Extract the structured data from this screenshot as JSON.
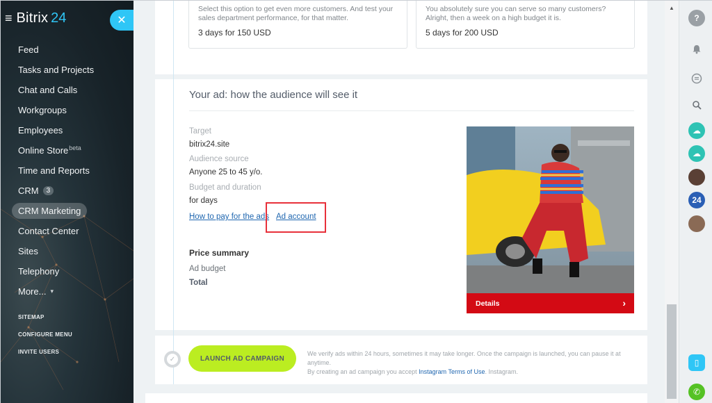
{
  "sidebar": {
    "logo": "Bitrix",
    "logo_num": "24",
    "items": [
      {
        "label": "Feed"
      },
      {
        "label": "Tasks and Projects"
      },
      {
        "label": "Chat and Calls"
      },
      {
        "label": "Workgroups"
      },
      {
        "label": "Employees"
      },
      {
        "label": "Online Store",
        "sup": "beta"
      },
      {
        "label": "Time and Reports"
      },
      {
        "label": "CRM",
        "counter": "3"
      },
      {
        "label": "CRM Marketing"
      },
      {
        "label": "Contact Center"
      },
      {
        "label": "Sites"
      },
      {
        "label": "Telephony"
      },
      {
        "label": "More..."
      }
    ],
    "links": [
      "SITEMAP",
      "CONFIGURE MENU",
      "INVITE USERS"
    ]
  },
  "options": [
    {
      "desc": "Select this option to get even more customers. And test your sales department performance, for that matter.",
      "price": "3 days for 150 USD"
    },
    {
      "desc": "You absolutely sure you can serve so many customers? Alright, then a week on a high budget it is.",
      "price": "5 days for 200 USD"
    }
  ],
  "preview": {
    "title": "Your ad: how the audience will see it",
    "target_label": "Target",
    "target_value": "bitrix24.site",
    "audience_label": "Audience source",
    "audience_value": "Anyone 25 to 45 y/o.",
    "budget_label": "Budget and duration",
    "budget_value": "for days",
    "link_pay": "How to pay for the ads",
    "link_account": "Ad account",
    "price_summary": "Price summary",
    "ad_budget": "Ad budget",
    "total": "Total",
    "details": "Details"
  },
  "launch": {
    "button": "LAUNCH AD CAMPAIGN",
    "note_1": "We verify ads within 24 hours, sometimes it may take longer. Once the campaign is launched, you can pause it at anytime.",
    "note_2a": "By creating an ad campaign you accept ",
    "note_link": "Instagram Terms of Use",
    "note_2b": ". Instagram."
  },
  "rightbar": {
    "help": "?",
    "counter_badge": "24"
  },
  "colors": {
    "accent": "#2fc6f6",
    "launch": "#bbed21",
    "details_bar": "#d30a14",
    "highlight": "#e8303a"
  }
}
